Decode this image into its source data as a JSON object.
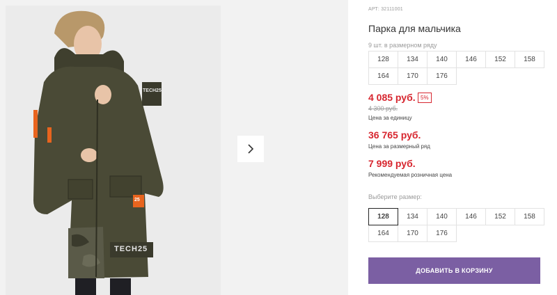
{
  "product": {
    "sku": "АРТ: 32111001",
    "title": "Парка для мальчика",
    "pack_note": "9 шт. в размерном ряду",
    "pack_sizes": [
      "128",
      "134",
      "140",
      "146",
      "152",
      "158",
      "164",
      "170",
      "176"
    ],
    "price_unit": "4 085 руб.",
    "discount_badge": "5%",
    "old_price": "4 300 руб.",
    "price_unit_label": "Цена за единицу",
    "price_pack": "36 765 руб.",
    "price_pack_label": "Цена за размерный ряд",
    "price_retail": "7 999 руб.",
    "price_retail_label": "Рекомендуемая розничная цена",
    "choose_size_label": "Выберите размер:",
    "select_sizes": [
      "128",
      "134",
      "140",
      "146",
      "152",
      "158",
      "164",
      "170",
      "176"
    ],
    "selected_size": "128",
    "add_to_cart": "ДОБАВИТЬ В КОРЗИНУ",
    "jacket_print_text": "TECH25",
    "patch_text": "25"
  },
  "colors": {
    "accent_price": "#d7262f",
    "button": "#7b5fa3",
    "jacket": "#4a4a36"
  },
  "icons": {
    "next": "chevron-right-icon"
  }
}
